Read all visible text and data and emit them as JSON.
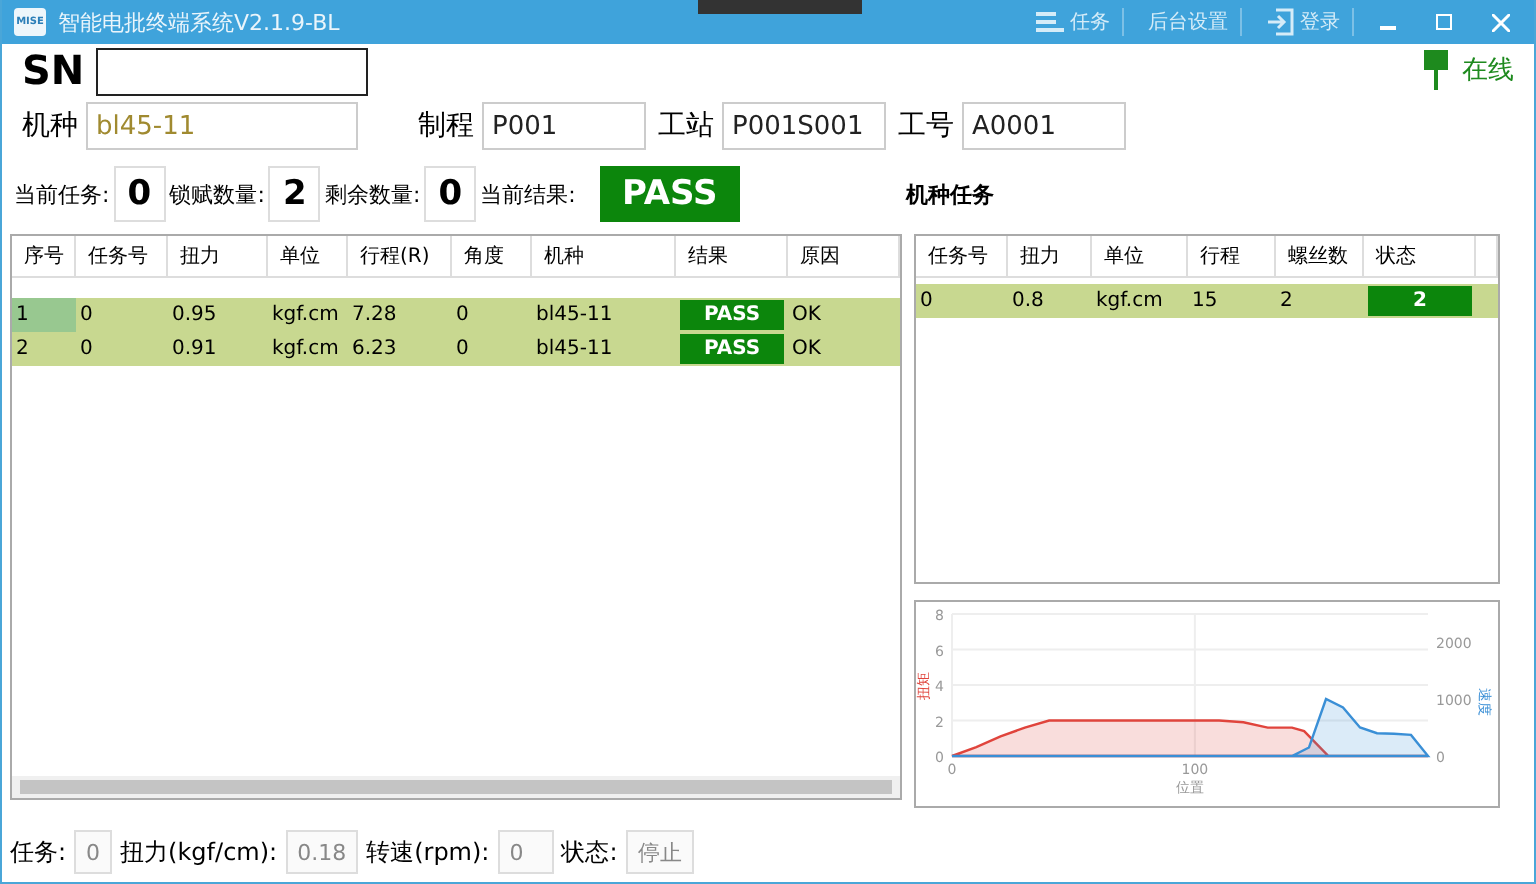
{
  "window": {
    "logo": "MISE",
    "title": "智能电批终端系统V2.1.9-BL",
    "menu": [
      {
        "kind": "tasks",
        "label": "任务"
      },
      {
        "kind": "settings",
        "label": "后台设置"
      },
      {
        "kind": "login",
        "label": "登录"
      }
    ]
  },
  "sn": {
    "label": "SN"
  },
  "status": {
    "label": "在线",
    "online": true
  },
  "info": [
    {
      "label": "机种",
      "value": "bl45-11",
      "highlight": true
    },
    {
      "label": "制程",
      "value": "P001",
      "highlight": false
    },
    {
      "label": "工站",
      "value": "P001S001",
      "highlight": false
    },
    {
      "label": "工号",
      "value": "A0001",
      "highlight": false
    }
  ],
  "counters": [
    {
      "label": "当前任务:",
      "value": "0"
    },
    {
      "label": "锁赋数量:",
      "value": "2"
    },
    {
      "label": "剩余数量:",
      "value": "0"
    }
  ],
  "current_result": {
    "label": "当前结果:",
    "value": "PASS"
  },
  "model_tasks_title": "机种任务",
  "records": {
    "columns": [
      "序号",
      "任务号",
      "扭力",
      "单位",
      "行程(R)",
      "角度",
      "机种",
      "结果",
      "原因"
    ],
    "rows": [
      {
        "cells": [
          "1",
          "0",
          "0.95",
          "kgf.cm",
          "7.28",
          "0",
          "bl45-11"
        ],
        "result": "PASS",
        "reason": "OK",
        "selected": true
      },
      {
        "cells": [
          "2",
          "0",
          "0.91",
          "kgf.cm",
          "6.23",
          "0",
          "bl45-11"
        ],
        "result": "PASS",
        "reason": "OK",
        "selected": false
      }
    ]
  },
  "tasks": {
    "columns": [
      "任务号",
      "扭力",
      "单位",
      "行程",
      "螺丝数",
      "状态"
    ],
    "rows": [
      {
        "cells": [
          "0",
          "0.8",
          "kgf.cm",
          "15",
          "2"
        ],
        "status": "2"
      }
    ]
  },
  "chart": {
    "torque": {
      "chart_data": {
        "type": "area",
        "xlabel": "位置",
        "x": [
          0,
          10,
          20,
          30,
          40,
          50,
          60,
          70,
          80,
          90,
          100,
          110,
          120,
          130,
          140,
          145,
          150,
          155,
          160,
          170,
          180,
          190,
          196
        ],
        "xlim": [
          0,
          196
        ],
        "xticks": [
          0,
          100
        ],
        "ylim": [
          0,
          8
        ],
        "yticks": [
          0,
          2,
          4,
          6,
          8
        ],
        "grid": true,
        "series": [
          {
            "name": "扭矩",
            "color": "#e0443c",
            "values": [
              0,
              0.5,
              1.1,
              1.6,
              2,
              2,
              2,
              2,
              2,
              2,
              2,
              2,
              1.9,
              1.6,
              1.6,
              1.4,
              0.7,
              0,
              0,
              0,
              0,
              0,
              0
            ]
          }
        ]
      }
    },
    "speed": {
      "chart_data": {
        "type": "area",
        "ylim": [
          0,
          2000
        ],
        "yticks": [
          0,
          1000,
          2000
        ],
        "series": [
          {
            "name": "速度",
            "color": "#3a8fd6",
            "values": [
              0,
              0,
              0,
              0,
              0,
              0,
              0,
              0,
              0,
              0,
              0,
              0,
              0,
              0,
              0,
              0,
              0,
              0,
              0,
              0,
              0,
              150,
              1000,
              850,
              500,
              400,
              390,
              370,
              0
            ]
          }
        ]
      }
    }
  },
  "footer": [
    {
      "label": "任务:",
      "value": "0"
    },
    {
      "label": "扭力(kgf/cm):",
      "value": "0.18"
    },
    {
      "label": "转速(rpm):",
      "value": "0"
    },
    {
      "label": "状态:",
      "value": "停止"
    }
  ]
}
